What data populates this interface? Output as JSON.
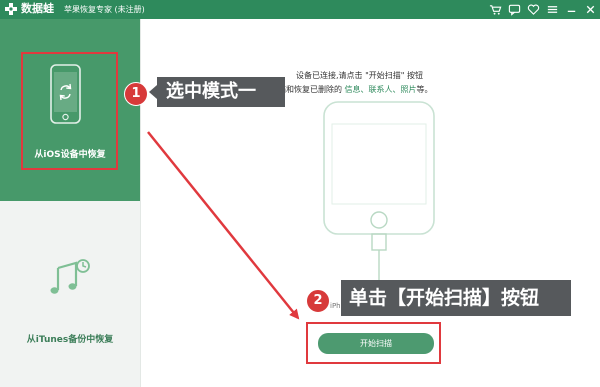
{
  "titlebar": {
    "app_name": "数据蛙",
    "subtitle": "苹果恢复专家 (未注册)"
  },
  "window_icons": [
    "cart-icon",
    "chat-icon",
    "heart-icon",
    "menu-icon",
    "minimize-icon",
    "close-icon"
  ],
  "sidebar": {
    "mode1_label": "从iOS设备中恢复",
    "mode2_label": "从iTunes备份中恢复"
  },
  "main": {
    "instruction_line1": "设备已连接,请点击 \"开始扫描\" 按钮",
    "instruction_line2_prefix": "进行扫描和恢复已删除的 ",
    "instruction_links": "信息、联系人、照片",
    "instruction_line2_suffix": "等。",
    "device_label": "iPhone",
    "scan_button": "开始扫描"
  },
  "annotations": {
    "badge1": "1",
    "callout1": "选中模式一",
    "badge2": "2",
    "callout2": "单击【开始扫描】按钮"
  },
  "colors": {
    "brand_green": "#2e8a5c",
    "selected_mode": "#47996a",
    "annotation_red": "#e0393e",
    "callout_gray": "#56595c"
  }
}
